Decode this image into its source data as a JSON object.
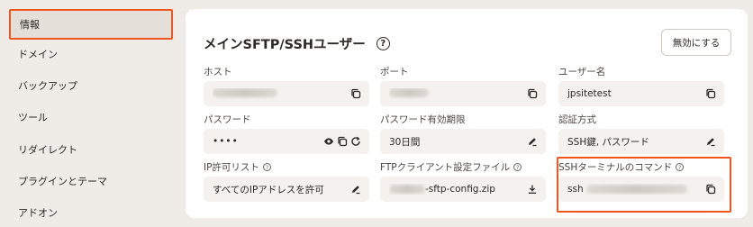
{
  "sidebar": {
    "items": [
      {
        "label": "情報",
        "active": true
      },
      {
        "label": "ドメイン"
      },
      {
        "label": "バックアップ"
      },
      {
        "label": "ツール"
      },
      {
        "label": "リダイレクト"
      },
      {
        "label": "プラグインとテーマ"
      },
      {
        "label": "アドオン"
      }
    ]
  },
  "main": {
    "title": "メインSFTP/SSHユーザー",
    "disable_button": "無効にする",
    "fields": {
      "host": {
        "label": "ホスト",
        "value": ""
      },
      "port": {
        "label": "ポート",
        "value": ""
      },
      "username": {
        "label": "ユーザー名",
        "value": "jpsitetest"
      },
      "password": {
        "label": "パスワード",
        "value": "••••"
      },
      "password_expiry": {
        "label": "パスワード有効期限",
        "value": "30日間"
      },
      "auth_method": {
        "label": "認証方式",
        "value": "SSH鍵, パスワード"
      },
      "ip_allowlist": {
        "label": "IP許可リスト",
        "value": "すべてのIPアドレスを許可"
      },
      "ftp_config": {
        "label": "FTPクライアント設定ファイル",
        "value": "-sftp-config.zip"
      },
      "ssh_command": {
        "label": "SSHターミナルのコマンド",
        "value": "ssh"
      }
    }
  },
  "colors": {
    "highlight": "#f0561e",
    "background": "#efebe7",
    "field_bg": "#f4f1ee"
  }
}
